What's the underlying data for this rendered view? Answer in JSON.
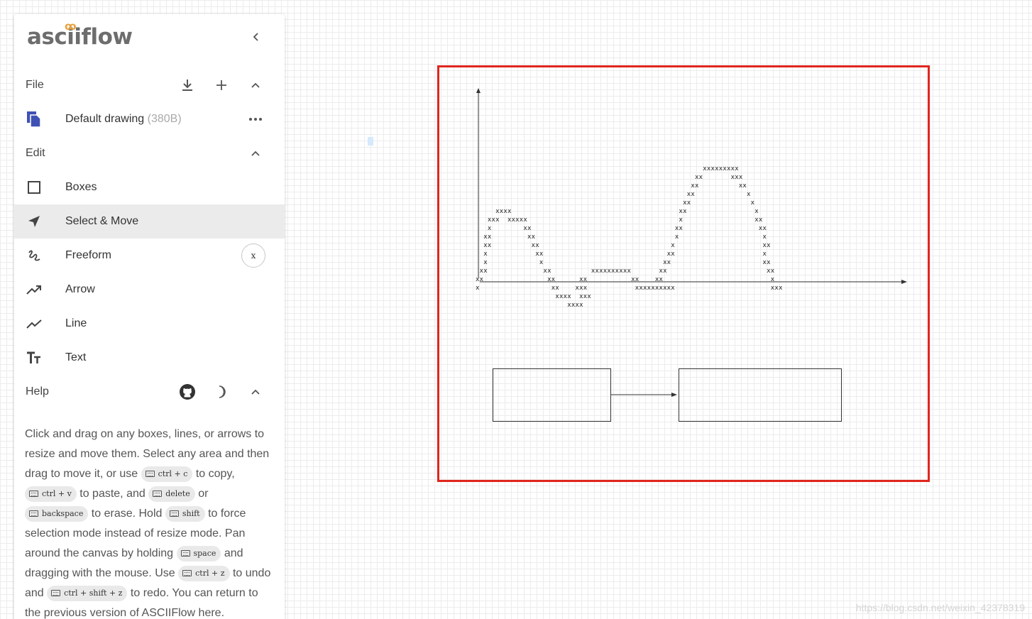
{
  "app": {
    "logo_text": "asciiflow",
    "collapse_icon": "chevron-left-icon"
  },
  "file_section": {
    "title": "File",
    "drawing_name": "Default drawing",
    "drawing_size": "(380B)"
  },
  "edit_section": {
    "title": "Edit",
    "tools": [
      {
        "label": "Boxes",
        "icon": "square-icon",
        "selected": false
      },
      {
        "label": "Select & Move",
        "icon": "navigation-arrow-icon",
        "selected": true
      },
      {
        "label": "Freeform",
        "icon": "gesture-icon",
        "selected": false,
        "shortcut": "x"
      },
      {
        "label": "Arrow",
        "icon": "trending-up-icon",
        "selected": false
      },
      {
        "label": "Line",
        "icon": "show-chart-icon",
        "selected": false
      },
      {
        "label": "Text",
        "icon": "text-fields-icon",
        "selected": false
      }
    ]
  },
  "help_section": {
    "title": "Help",
    "t1": "Click and drag on any boxes, lines, or arrows to resize and move them. Select any area and then drag to move it, or use",
    "k_copy": "ctrl + c",
    "t2": "to copy,",
    "k_paste": "ctrl + v",
    "t3": "to paste, and",
    "k_delete": "delete",
    "t4": "or",
    "k_backspace": "backspace",
    "t5": "to erase. Hold",
    "k_shift": "shift",
    "t6": "to force selection mode instead of resize mode. Pan around the canvas by holding",
    "k_space": "space",
    "t7": "and dragging with the mouse. Use",
    "k_undo": "ctrl + z",
    "t8": "to undo and",
    "k_redo": "ctrl + shift + z",
    "t9": "to redo. You can return to the previous version of ASCIIFlow here."
  },
  "colors": {
    "frame": "#e0261e",
    "logo_accent": "#e8a13a",
    "file_icon": "#3f51b5",
    "selected_bg": "#ebebeb"
  },
  "canvas": {
    "curve_lines": [
      "                                                         xxxxxxxxx",
      "                                                       xx       xxx",
      "                                                      xx          xx",
      "                                                     xx             x",
      "                                                    xx               x",
      "     xxxx                                          xx                 x",
      "   xxx  xxxxx                                      x                  xx",
      "   x        xx                                    xx                   xx",
      "  xx         xx                                   x                     x",
      "  xx          xx                                 x                      xx",
      "  x            xx                               xx                      x",
      "  x             x                              xx                       xx",
      " xx              xx          xxxxxxxxxx       xx                         xx",
      "xx                xx      xx           xx    xx                           x",
      "x                  xx    xxx            xxxxxxxxxx                        xxx",
      "                    xxxx  xxx",
      "                       xxxx"
    ],
    "watermark": "https://blog.csdn.net/weixin_42378319"
  }
}
